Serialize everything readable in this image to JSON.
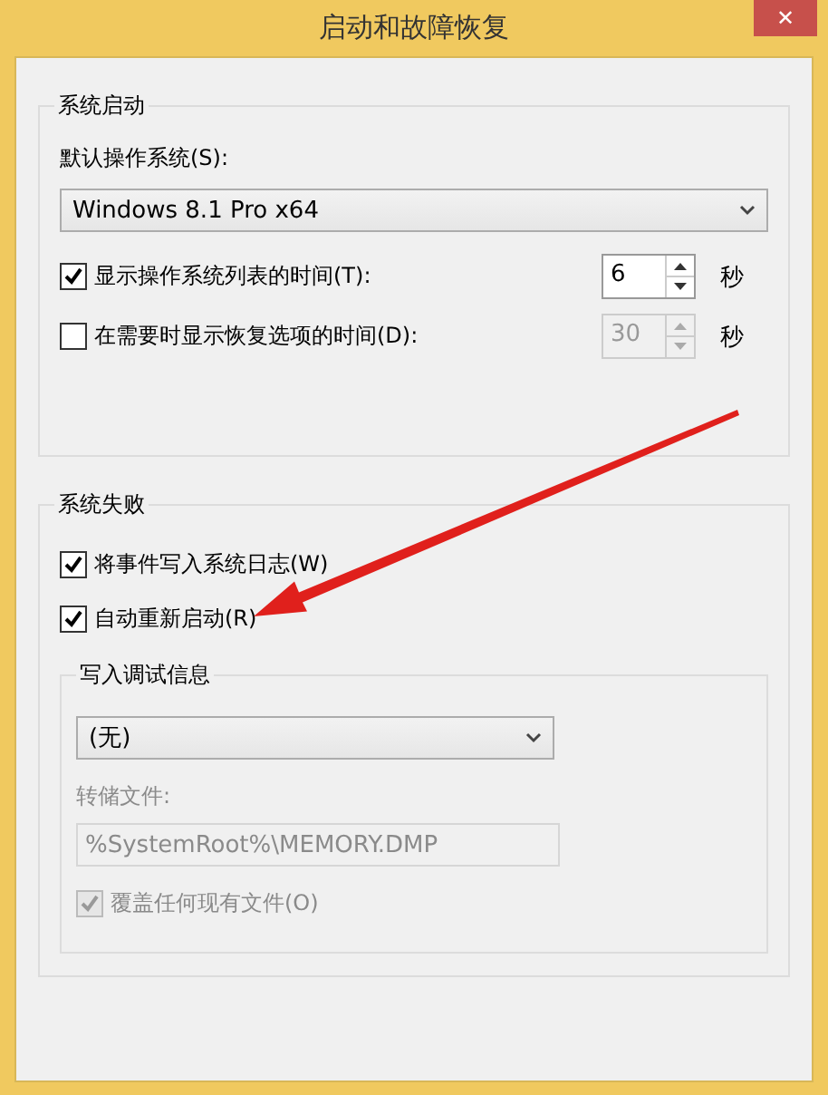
{
  "window": {
    "title": "启动和故障恢复",
    "close": "✕"
  },
  "startup": {
    "title": "系统启动",
    "os_label": "默认操作系统(S):",
    "os_value": "Windows 8.1 Pro x64",
    "timers": [
      {
        "label": "显示操作系统列表的时间(T):",
        "checked": true,
        "value": "6",
        "disabled": false,
        "unit": "秒"
      },
      {
        "label": "在需要时显示恢复选项的时间(D):",
        "checked": false,
        "value": "30",
        "disabled": true,
        "unit": "秒"
      }
    ]
  },
  "failure": {
    "title": "系统失败",
    "options": [
      {
        "label": "将事件写入系统日志(W)",
        "checked": true
      },
      {
        "label": "自动重新启动(R)",
        "checked": true
      }
    ],
    "debug": {
      "title": "写入调试信息",
      "type_value": "(无)",
      "dump_label": "转储文件:",
      "dump_value": "%SystemRoot%\\MEMORY.DMP",
      "disabled": true,
      "overwrite": {
        "label": "覆盖任何现有文件(O)",
        "checked": true,
        "disabled": true
      }
    }
  },
  "annotation": {
    "kind": "arrow"
  }
}
